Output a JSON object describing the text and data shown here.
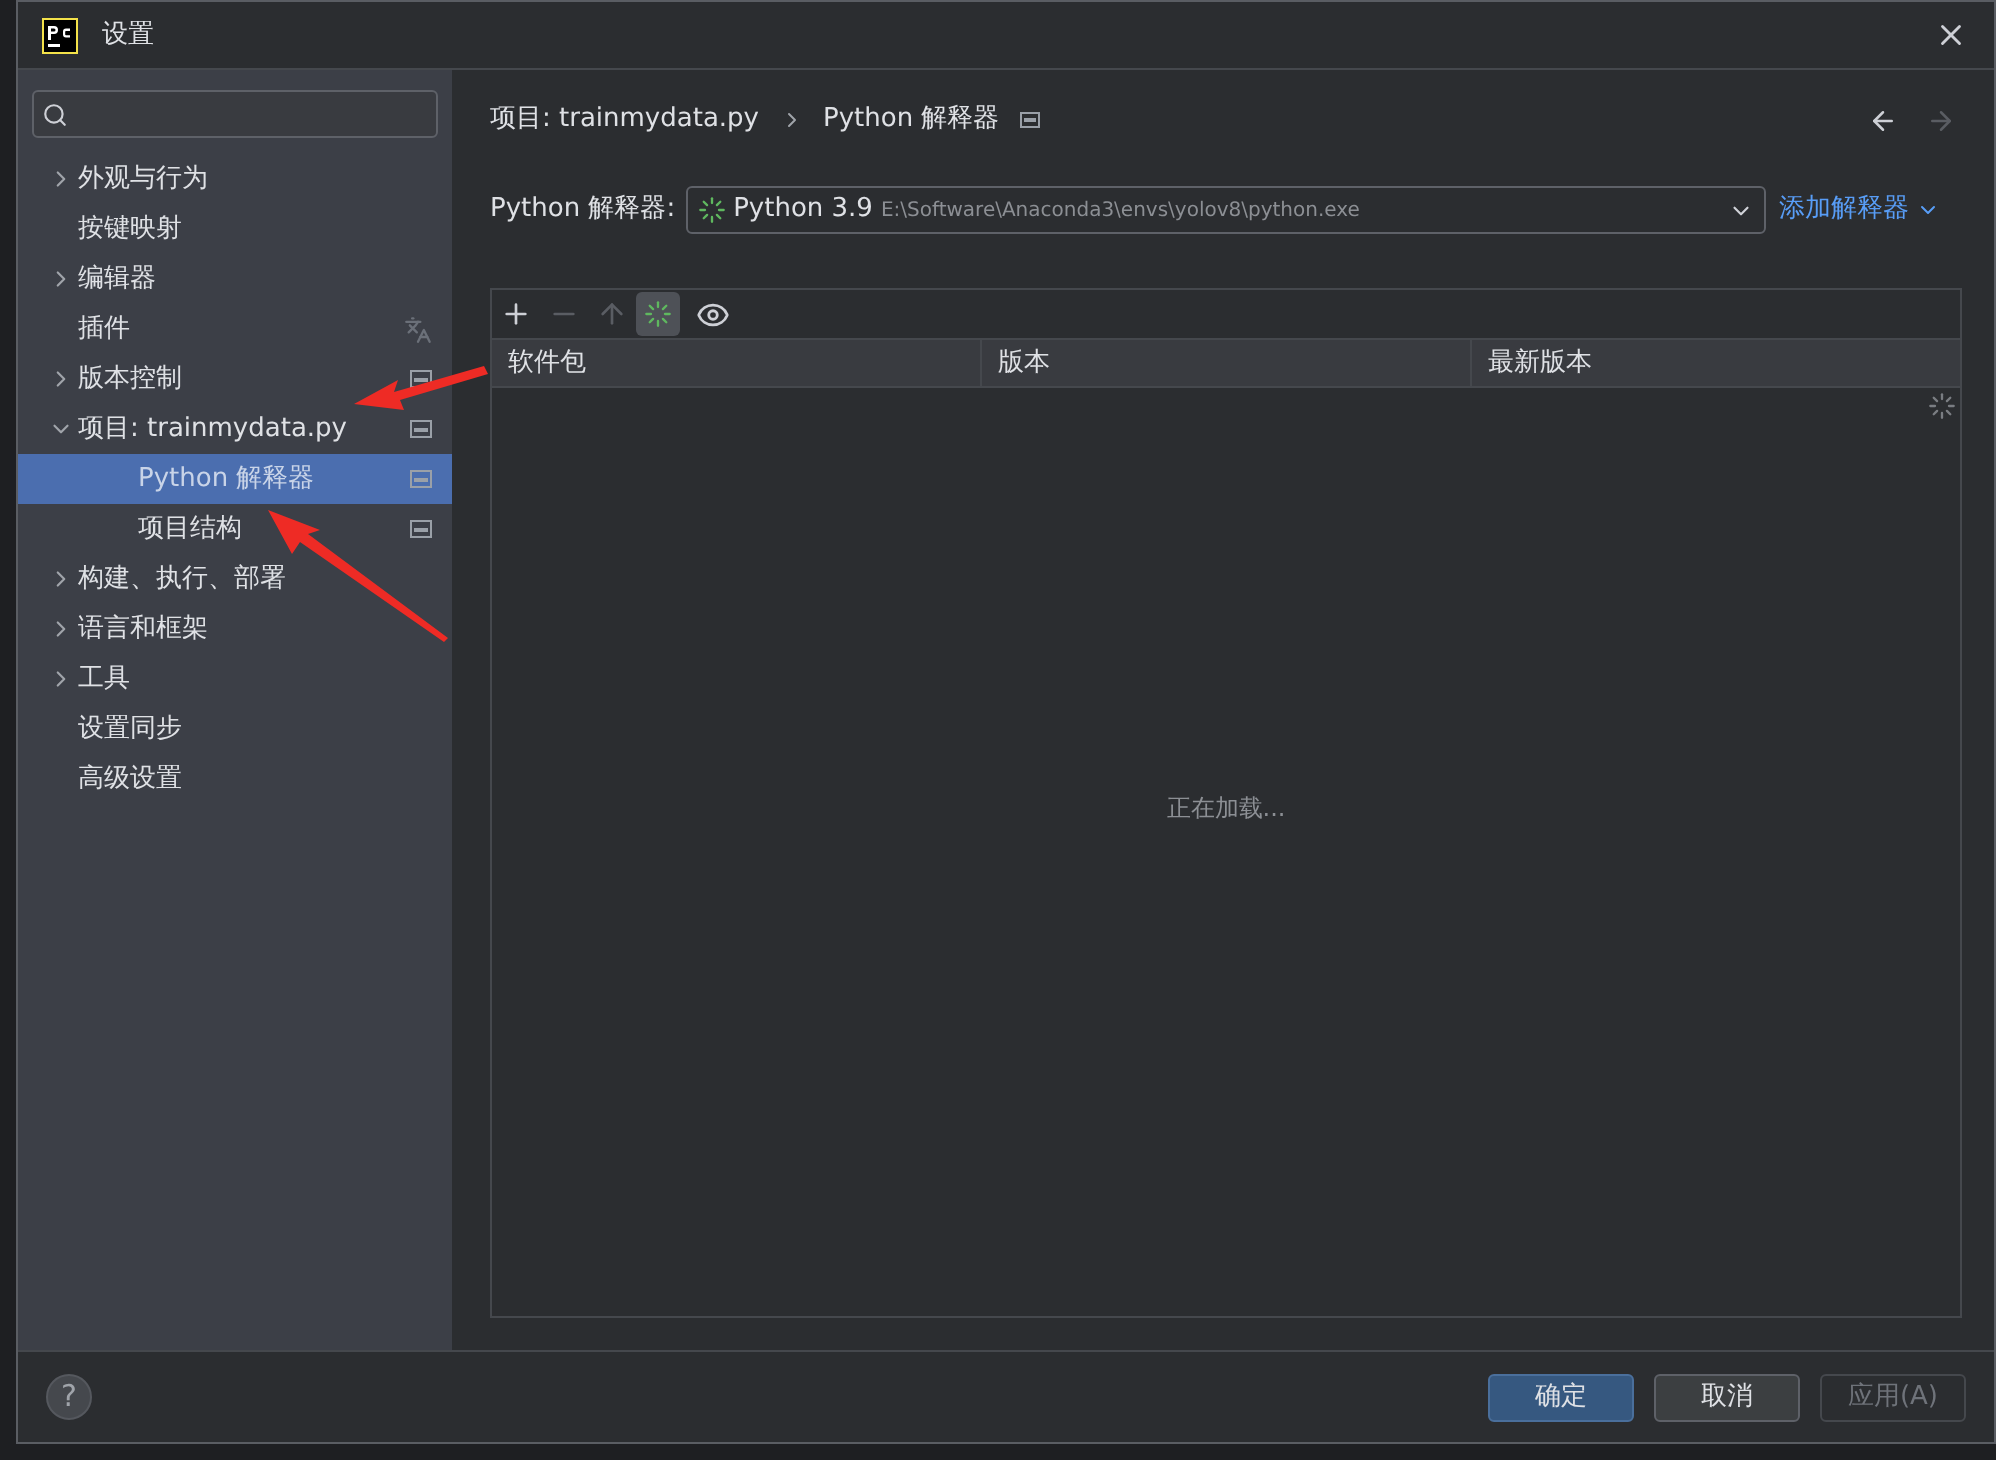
{
  "window": {
    "title": "设置"
  },
  "sidebar": {
    "items": [
      {
        "label": "外观与行为",
        "kind": "group",
        "expanded": false,
        "selected": false,
        "project_scoped": false,
        "translatable": false
      },
      {
        "label": "按键映射",
        "kind": "leaf",
        "selected": false,
        "project_scoped": false,
        "translatable": false
      },
      {
        "label": "编辑器",
        "kind": "group",
        "expanded": false,
        "selected": false,
        "project_scoped": false,
        "translatable": false
      },
      {
        "label": "插件",
        "kind": "leaf",
        "selected": false,
        "project_scoped": false,
        "translatable": true
      },
      {
        "label": "版本控制",
        "kind": "group",
        "expanded": false,
        "selected": false,
        "project_scoped": true,
        "translatable": false
      },
      {
        "label": "项目: trainmydata.py",
        "kind": "group",
        "expanded": true,
        "selected": false,
        "project_scoped": true,
        "translatable": false,
        "children": [
          {
            "label": "Python 解释器",
            "selected": true,
            "project_scoped": true,
            "translatable": false
          },
          {
            "label": "项目结构",
            "selected": false,
            "project_scoped": true,
            "translatable": false
          }
        ]
      },
      {
        "label": "构建、执行、部署",
        "kind": "group",
        "expanded": false,
        "selected": false,
        "project_scoped": false,
        "translatable": false
      },
      {
        "label": "语言和框架",
        "kind": "group",
        "expanded": false,
        "selected": false,
        "project_scoped": false,
        "translatable": false
      },
      {
        "label": "工具",
        "kind": "group",
        "expanded": false,
        "selected": false,
        "project_scoped": false,
        "translatable": false
      },
      {
        "label": "设置同步",
        "kind": "leaf",
        "selected": false,
        "project_scoped": false,
        "translatable": false
      },
      {
        "label": "高级设置",
        "kind": "leaf",
        "selected": false,
        "project_scoped": false,
        "translatable": false
      }
    ]
  },
  "breadcrumb": [
    "项目: trainmydata.py",
    "Python 解释器"
  ],
  "interpreter": {
    "label": "Python 解释器:",
    "name": "Python 3.9",
    "path": "E:\\Software\\Anaconda3\\envs\\yolov8\\python.exe",
    "add_link": "添加解释器"
  },
  "table": {
    "columns": [
      "软件包",
      "版本",
      "最新版本"
    ],
    "loading": "正在加载..."
  },
  "help_button": "?",
  "buttons": [
    {
      "label": "确定",
      "kind": "primary",
      "disabled": false
    },
    {
      "label": "取消",
      "kind": "normal",
      "disabled": false
    },
    {
      "label": "应用(A)",
      "kind": "normal",
      "disabled": true
    }
  ]
}
